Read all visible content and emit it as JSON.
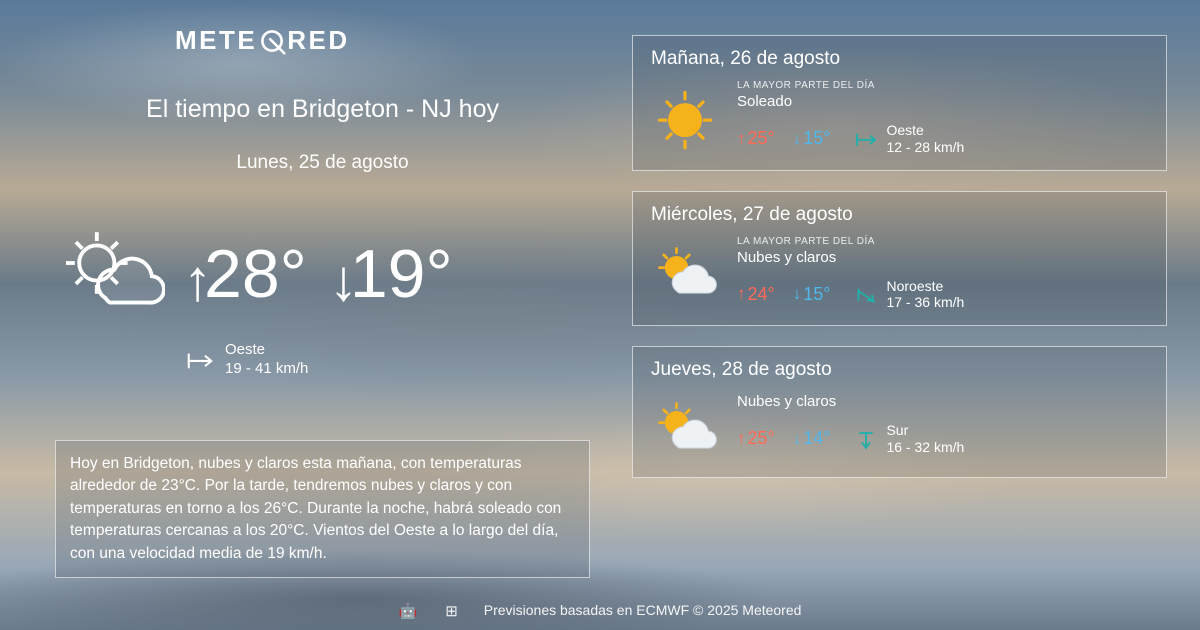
{
  "brand": {
    "name_part1": "METE",
    "name_part2": "RED"
  },
  "header": {
    "title": "El tiempo en Bridgeton - NJ hoy",
    "date": "Lunes, 25 de agosto"
  },
  "today": {
    "hi": "28°",
    "lo": "19°",
    "wind_dir": "Oeste",
    "wind_speed": "19 - 41 km/h"
  },
  "summary": "Hoy en Bridgeton, nubes y claros esta mañana, con temperaturas alrededor de 23°C. Por la tarde, tendremos nubes y claros y con temperaturas en torno a los 26°C. Durante la noche, habrá soleado  con temperaturas cercanas a los 20°C. Vientos del Oeste a lo largo del día, con una velocidad media de 19 km/h.",
  "most_of_day_label": "LA MAYOR PARTE DEL DÍA",
  "forecast": [
    {
      "date": "Mañana, 26 de agosto",
      "condition": "Soleado",
      "hi": "25°",
      "lo": "15°",
      "wind_dir": "Oeste",
      "wind_speed": "12 - 28 km/h",
      "icon": "sunny"
    },
    {
      "date": "Miércoles, 27 de agosto",
      "condition": "Nubes y claros",
      "hi": "24°",
      "lo": "15°",
      "wind_dir": "Noroeste",
      "wind_speed": "17 - 36 km/h",
      "icon": "partly"
    },
    {
      "date": "Jueves, 28 de agosto",
      "condition": "Nubes y claros",
      "hi": "25°",
      "lo": "14°",
      "wind_dir": "Sur",
      "wind_speed": "16 - 32 km/h",
      "icon": "partly"
    }
  ],
  "footer": {
    "text": "Previsiones basadas en ECMWF © 2025 Meteored"
  },
  "colors": {
    "hi": "#ff6a57",
    "lo": "#4fb7ea",
    "wind_accent": "#1fb0a9"
  }
}
